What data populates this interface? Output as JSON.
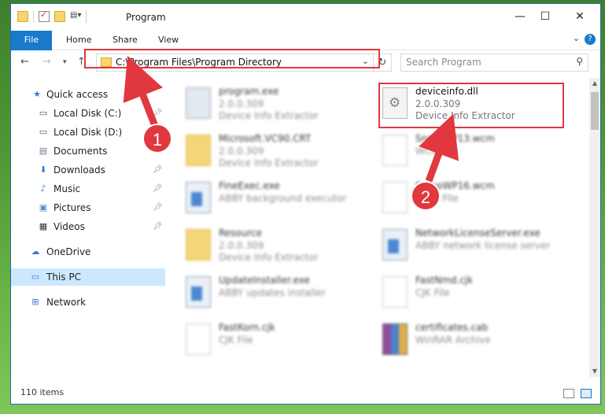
{
  "window": {
    "title": "Program",
    "minimize": "—",
    "maximize": "☐",
    "close": "✕"
  },
  "ribbon": {
    "tabs": [
      "File",
      "Home",
      "Share",
      "View"
    ],
    "help": "?"
  },
  "address": {
    "path": "C:\\Program Files\\Program Directory",
    "search_placeholder": "Search Program"
  },
  "sidebar": {
    "items": [
      {
        "label": "Quick access",
        "icon": "star-icon"
      },
      {
        "label": "Local Disk (C:)",
        "icon": "drive-icon",
        "pinned": true
      },
      {
        "label": "Local Disk (D:)",
        "icon": "drive-icon"
      },
      {
        "label": "Documents",
        "icon": "documents-icon"
      },
      {
        "label": "Downloads",
        "icon": "download-icon",
        "pinned": true
      },
      {
        "label": "Music",
        "icon": "music-icon",
        "pinned": true
      },
      {
        "label": "Pictures",
        "icon": "pictures-icon",
        "pinned": true
      },
      {
        "label": "Videos",
        "icon": "videos-icon",
        "pinned": true
      },
      {
        "label": "OneDrive",
        "icon": "cloud-icon"
      },
      {
        "label": "This PC",
        "icon": "computer-icon",
        "selected": true
      },
      {
        "label": "Network",
        "icon": "network-icon"
      }
    ]
  },
  "files": [
    {
      "name": "program.exe",
      "line1": "2.0.0.309",
      "line2": "Device Info Extractor",
      "icon": "exe-icon"
    },
    {
      "name": "deviceinfo.dll",
      "line1": "2.0.0.309",
      "line2": "Device Info Extractor",
      "icon": "dll-icon"
    },
    {
      "name": "Microsoft.VC90.CRT",
      "line1": "2.0.0.309",
      "line2": "Device Info Extractor",
      "icon": "folder-icon"
    },
    {
      "name": "SnmpWP13.wcm",
      "line1": "WCM File",
      "line2": "",
      "icon": "document-icon"
    },
    {
      "name": "FineExec.exe",
      "line1": "ABBY background executor",
      "line2": "",
      "icon": "app-icon"
    },
    {
      "name": "SnmpWP16.wcm",
      "line1": "WCM File",
      "line2": "",
      "icon": "document-icon"
    },
    {
      "name": "Resource",
      "line1": "2.0.0.309",
      "line2": "Device Info Extractor",
      "icon": "folder-icon"
    },
    {
      "name": "NetworkLicenseServer.exe",
      "line1": "ABBY network license server",
      "line2": "",
      "icon": "app-icon"
    },
    {
      "name": "UpdateInstaller.exe",
      "line1": "ABBY updates installer",
      "line2": "",
      "icon": "app-icon"
    },
    {
      "name": "FastNmd.cjk",
      "line1": "CJK File",
      "line2": "",
      "icon": "document-icon"
    },
    {
      "name": "FastKorn.cjk",
      "line1": "CJK File",
      "line2": "",
      "icon": "document-icon"
    },
    {
      "name": "certificates.cab",
      "line1": "WinRAR Archive",
      "line2": "",
      "icon": "rar-icon"
    }
  ],
  "status": {
    "count": "110 items"
  },
  "annotations": {
    "badge1": "1",
    "badge2": "2",
    "color": "#e0383e"
  }
}
